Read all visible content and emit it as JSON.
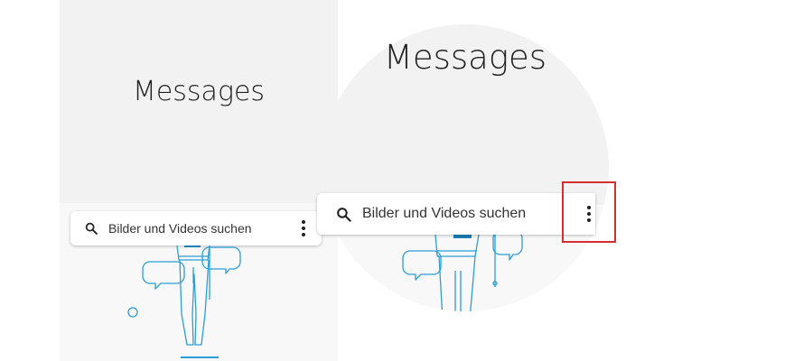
{
  "left_panel": {
    "title": "Messages",
    "search": {
      "placeholder": "Bilder und Videos suchen",
      "icon": "search-icon",
      "menu_icon": "more-vert-icon"
    }
  },
  "zoom_view": {
    "title": "Messages",
    "search": {
      "placeholder": "Bilder und Videos suchen",
      "icon": "search-icon",
      "menu_icon": "more-vert-icon"
    },
    "highlight_color": "#d32f2f"
  },
  "colors": {
    "header_bg": "#f2f2f2",
    "illustration_stroke": "#2a9fd6",
    "illustration_accent": "#1a7fb5"
  }
}
